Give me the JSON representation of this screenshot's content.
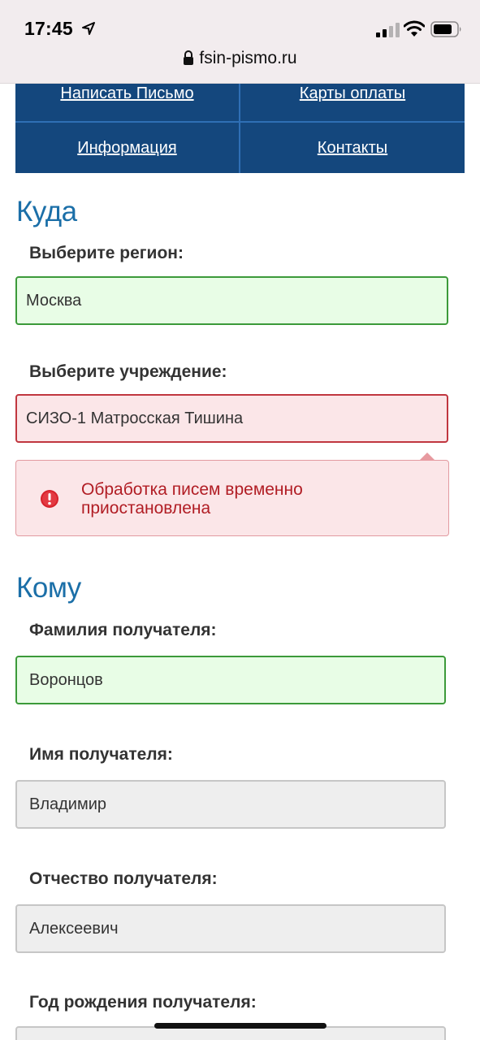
{
  "status_bar": {
    "time": "17:45",
    "icons": [
      "location-arrow-icon",
      "cellular-signal-icon",
      "wifi-icon",
      "battery-icon"
    ]
  },
  "browser": {
    "url": "fsin-pismo.ru"
  },
  "nav": {
    "items": [
      {
        "label": "Написать Письмо"
      },
      {
        "label": "Карты оплаты"
      },
      {
        "label": "Информация"
      },
      {
        "label": "Контакты"
      }
    ]
  },
  "where": {
    "heading": "Куда",
    "region_label": "Выберите регион:",
    "region_value": "Москва",
    "institution_label": "Выберите учреждение:",
    "institution_value": "СИЗО-1 Матросская Тишина",
    "error_message": "Обработка писем временно приостановлена"
  },
  "to_whom": {
    "heading": "Кому",
    "surname_label": "Фамилия получателя:",
    "surname_value": "Воронцов",
    "name_label": "Имя получателя:",
    "name_value": "Владимир",
    "patronymic_label": "Отчество получателя:",
    "patronymic_value": "Алексеевич",
    "birth_year_label": "Год рождения получателя:",
    "birth_year_value": ""
  },
  "colors": {
    "nav_bg": "#14477d",
    "heading": "#1b6fa8",
    "valid_bg": "#e8fde6",
    "valid_border": "#3c9a3a",
    "error_bg": "#fbe6e8",
    "error_border": "#c0363f",
    "error_text": "#b11d24"
  }
}
